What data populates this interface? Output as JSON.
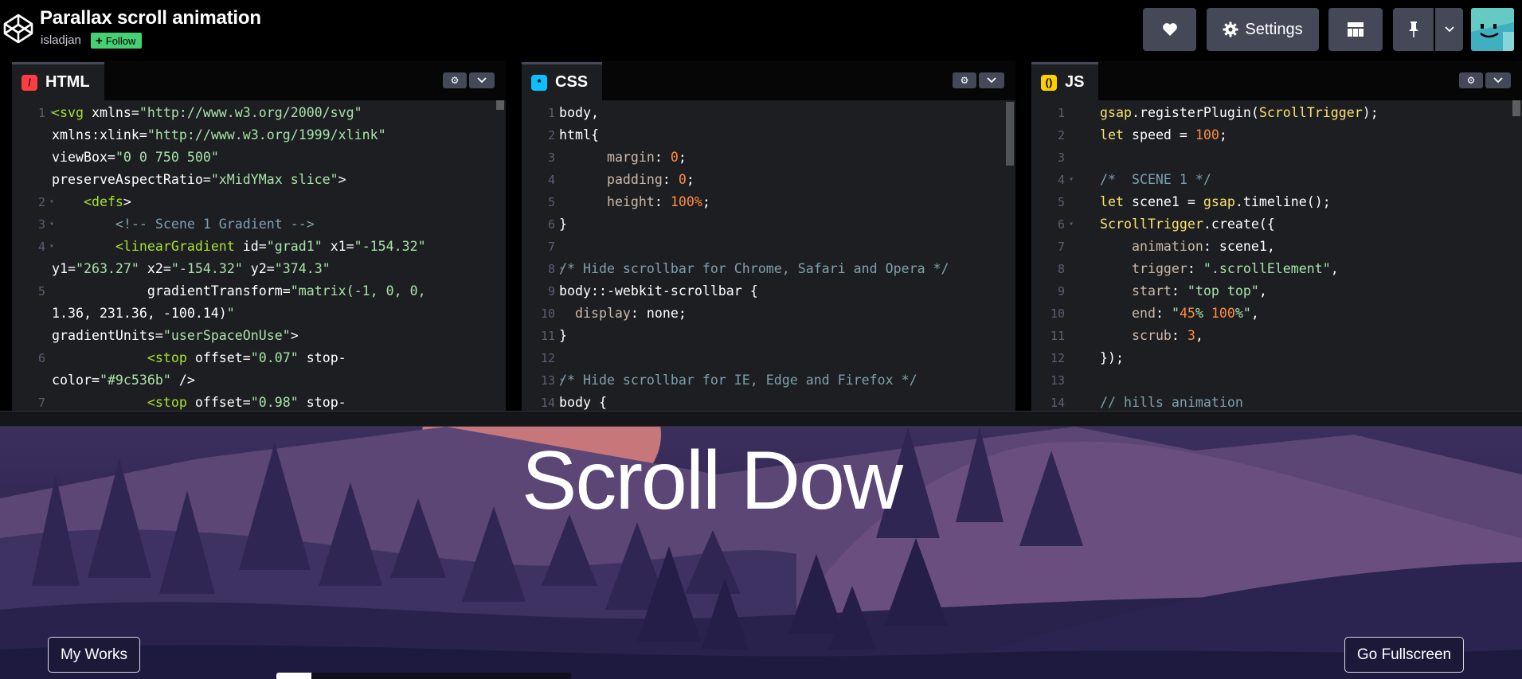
{
  "header": {
    "title": "Parallax scroll animation",
    "author": "isladjan",
    "follow_label": "Follow",
    "settings_label": "Settings",
    "icons": [
      "codepen-logo-icon",
      "heart-icon",
      "gear-icon",
      "layout-icon",
      "pin-icon",
      "chevron-down-icon"
    ]
  },
  "editors": {
    "html": {
      "tab": "HTML",
      "lines": [
        {
          "n": "1",
          "fold": true,
          "t": "<svg xmlns=\"http://www.w3.org/2000/svg\""
        },
        {
          "n": "",
          "fold": false,
          "t": "xmlns:xlink=\"http://www.w3.org/1999/xlink\""
        },
        {
          "n": "",
          "fold": false,
          "t": "viewBox=\"0 0 750 500\""
        },
        {
          "n": "",
          "fold": false,
          "t": "preserveAspectRatio=\"xMidYMax slice\">"
        },
        {
          "n": "2",
          "fold": true,
          "t": "    <defs>"
        },
        {
          "n": "3",
          "fold": true,
          "t": "        <!-- Scene 1 Gradient -->"
        },
        {
          "n": "4",
          "fold": true,
          "t": "        <linearGradient id=\"grad1\" x1=\"-154.32\""
        },
        {
          "n": "",
          "fold": false,
          "t": "y1=\"263.27\" x2=\"-154.32\" y2=\"374.3\""
        },
        {
          "n": "5",
          "fold": false,
          "t": "            gradientTransform=\"matrix(-1, 0, 0,"
        },
        {
          "n": "",
          "fold": false,
          "t": "1.36, 231.36, -100.14)\""
        },
        {
          "n": "",
          "fold": false,
          "t": "gradientUnits=\"userSpaceOnUse\">"
        },
        {
          "n": "6",
          "fold": false,
          "t": "            <stop offset=\"0.07\" stop-"
        },
        {
          "n": "",
          "fold": false,
          "t": "color=\"#9c536b\" />"
        },
        {
          "n": "7",
          "fold": false,
          "t": "            <stop offset=\"0.98\" stop-"
        }
      ]
    },
    "css": {
      "tab": "CSS",
      "lines": [
        {
          "n": "1",
          "fold": false,
          "t": "body,"
        },
        {
          "n": "2",
          "fold": true,
          "t": "html{"
        },
        {
          "n": "3",
          "fold": false,
          "t": "      margin: 0;"
        },
        {
          "n": "4",
          "fold": false,
          "t": "      padding: 0;"
        },
        {
          "n": "5",
          "fold": false,
          "t": "      height: 100%;"
        },
        {
          "n": "6",
          "fold": false,
          "t": "}"
        },
        {
          "n": "7",
          "fold": false,
          "t": ""
        },
        {
          "n": "8",
          "fold": true,
          "t": "/* Hide scrollbar for Chrome, Safari and Opera */"
        },
        {
          "n": "9",
          "fold": true,
          "t": "body::-webkit-scrollbar {"
        },
        {
          "n": "10",
          "fold": false,
          "t": "  display: none;"
        },
        {
          "n": "11",
          "fold": false,
          "t": "}"
        },
        {
          "n": "12",
          "fold": false,
          "t": ""
        },
        {
          "n": "13",
          "fold": true,
          "t": "/* Hide scrollbar for IE, Edge and Firefox */"
        },
        {
          "n": "14",
          "fold": true,
          "t": "body {"
        }
      ]
    },
    "js": {
      "tab": "JS",
      "lines": [
        {
          "n": "1",
          "fold": false,
          "t": "gsap.registerPlugin(ScrollTrigger);"
        },
        {
          "n": "2",
          "fold": false,
          "t": "let speed = 100;"
        },
        {
          "n": "3",
          "fold": false,
          "t": ""
        },
        {
          "n": "4",
          "fold": true,
          "t": "/*  SCENE 1 */"
        },
        {
          "n": "5",
          "fold": false,
          "t": "let scene1 = gsap.timeline();"
        },
        {
          "n": "6",
          "fold": true,
          "t": "ScrollTrigger.create({"
        },
        {
          "n": "7",
          "fold": false,
          "t": "    animation: scene1,"
        },
        {
          "n": "8",
          "fold": false,
          "t": "    trigger: \".scrollElement\","
        },
        {
          "n": "9",
          "fold": false,
          "t": "    start: \"top top\","
        },
        {
          "n": "10",
          "fold": false,
          "t": "    end: \"45% 100%\","
        },
        {
          "n": "11",
          "fold": false,
          "t": "    scrub: 3,"
        },
        {
          "n": "12",
          "fold": false,
          "t": "});"
        },
        {
          "n": "13",
          "fold": false,
          "t": ""
        },
        {
          "n": "14",
          "fold": false,
          "t": "// hills animation"
        }
      ]
    }
  },
  "preview": {
    "headline": "Scroll Dow",
    "my_works_label": "My Works",
    "fullscreen_label": "Go Fullscreen",
    "scroll_progress": 0.12
  },
  "colors": {
    "follow_green": "#47cf73",
    "button_bg": "#444857",
    "editor_bg": "#1d1e22",
    "html_icon": "#ff3c41",
    "css_icon": "#0ebeff",
    "js_icon": "#fcd000",
    "sky": "#231f45"
  }
}
